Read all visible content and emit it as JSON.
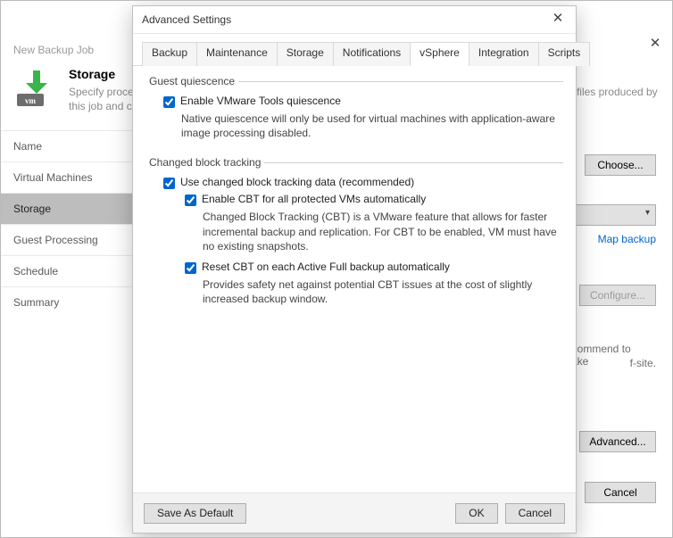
{
  "wizard": {
    "window_title": "New Backup Job",
    "close_glyph": "✕",
    "step_title": "Storage",
    "step_desc": "Specify processing proxy server to be used for source data retrieval, backup repository to store the backup files produced by this job and customize advanced job settings if required.",
    "steps": [
      "Name",
      "Virtual Machines",
      "Storage",
      "Guest Processing",
      "Schedule",
      "Summary"
    ],
    "right": {
      "choose": "Choose...",
      "map_backup": "Map backup",
      "configure": "Configure...",
      "recommend1": "recommend to make",
      "recommend2": "f-site.",
      "advanced": "Advanced...",
      "cancel": "Cancel"
    }
  },
  "dialog": {
    "title": "Advanced Settings",
    "close_glyph": "✕",
    "tabs": [
      "Backup",
      "Maintenance",
      "Storage",
      "Notifications",
      "vSphere",
      "Integration",
      "Scripts"
    ],
    "active_tab": "vSphere",
    "guest": {
      "legend": "Guest quiescence",
      "enable_label": "Enable VMware Tools quiescence",
      "enable_checked": true,
      "desc": "Native quiescence will only be used for virtual machines with application-aware image processing disabled."
    },
    "cbt": {
      "legend": "Changed block tracking",
      "use_label": "Use changed block tracking data (recommended)",
      "use_checked": true,
      "enable_all_label": "Enable CBT for all protected VMs automatically",
      "enable_all_checked": true,
      "enable_all_desc": "Changed Block Tracking (CBT) is a VMware feature that allows for faster incremental backup and replication. For CBT to be enabled, VM must have no existing snapshots.",
      "reset_label": "Reset CBT on each Active Full backup automatically",
      "reset_checked": true,
      "reset_desc": "Provides safety net against potential CBT issues at the cost of slightly increased backup window."
    },
    "buttons": {
      "save_default": "Save As Default",
      "ok": "OK",
      "cancel": "Cancel"
    }
  }
}
